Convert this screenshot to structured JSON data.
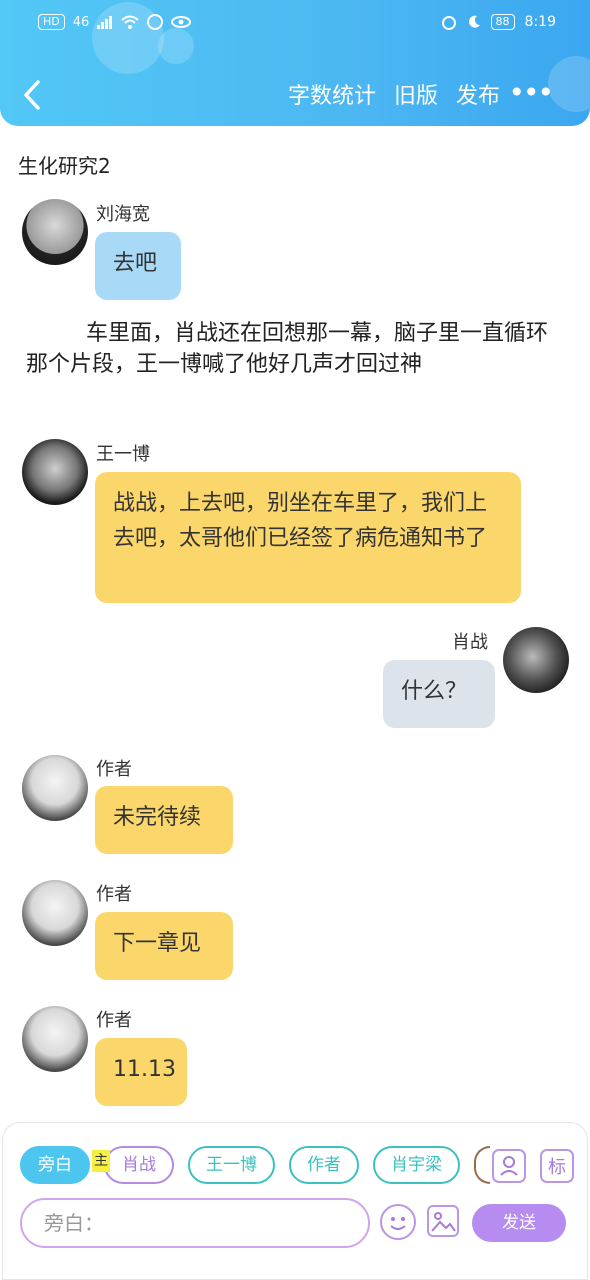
{
  "status_bar": {
    "left": [
      "HD",
      "46",
      "signal",
      "wifi",
      "data",
      "eye"
    ],
    "battery": "88",
    "time": "8:19"
  },
  "header": {
    "actions": [
      "字数统计",
      "旧版",
      "发布"
    ],
    "more": "•••"
  },
  "chapter": {
    "title": "生化研究2"
  },
  "messages": [
    {
      "name": "刘海宽",
      "text": "去吧"
    },
    {
      "narration": "车里面，肖战还在回想那一幕，脑子里一直循环那个片段，王一博喊了他好几声才回过神"
    },
    {
      "name": "王一博",
      "text": "战战，上去吧，别坐在车里了，我们上去吧，太哥他们已经签了病危通知书了"
    },
    {
      "name": "肖战",
      "text": "什么？"
    },
    {
      "name": "作者",
      "text": "未完待续"
    },
    {
      "name": "作者",
      "text": "下一章见"
    },
    {
      "name": "作者",
      "text": "11.13"
    }
  ],
  "composer": {
    "chips": [
      "旁白",
      "肖战",
      "王一博",
      "作者",
      "肖宇梁"
    ],
    "marker": "主",
    "tag_icon": "标",
    "placeholder": "旁白：",
    "send": "发送"
  },
  "colors": {
    "header": "#4cb7f2",
    "yellow_bubble": "#fbd76b",
    "blue_bubble": "#a8d9f7",
    "accent_purple": "#b78cf0",
    "teal": "#3cc1c0"
  }
}
